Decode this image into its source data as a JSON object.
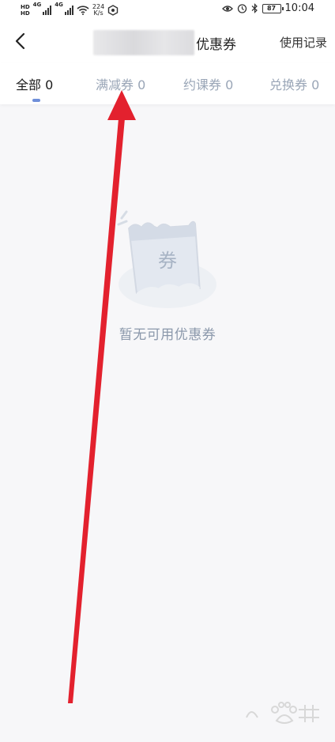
{
  "status_bar": {
    "network_left": "4G",
    "network_right": "4G",
    "speed_value": "224",
    "speed_unit": "K/s",
    "battery": "87",
    "time": "10:04"
  },
  "header": {
    "title": "优惠券",
    "history_label": "使用记录"
  },
  "tabs": [
    {
      "label": "全部 0",
      "active": true
    },
    {
      "label": "满减券 0",
      "active": false
    },
    {
      "label": "约课券 0",
      "active": false
    },
    {
      "label": "兑换券 0",
      "active": false
    }
  ],
  "empty_state": {
    "ticket_char": "券",
    "message": "暂无可用优惠券"
  },
  "colors": {
    "accent": "#6f8fd9",
    "tab_inactive": "#9aa6b7",
    "empty_text": "#8b98ab",
    "arrow": "#e3212e",
    "background": "#f7f7f9"
  },
  "icons": [
    "back-arrow-icon",
    "eye-icon",
    "alarm-icon",
    "bluetooth-icon",
    "wifi-icon",
    "signal-icon",
    "battery-icon",
    "coupon-ticket-icon"
  ]
}
